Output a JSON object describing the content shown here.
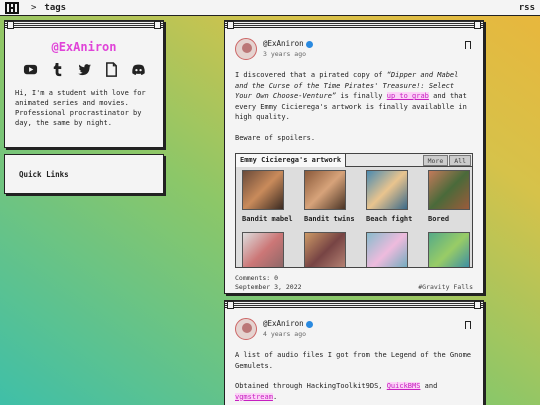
{
  "topbar": {
    "separator": ">",
    "breadcrumb": "tags",
    "rss": "rss"
  },
  "profile": {
    "handle": "@ExAniron",
    "socials": [
      "youtube-icon",
      "tumblr-icon",
      "twitter-icon",
      "document-icon",
      "discord-icon"
    ],
    "bio": "Hi, I'm a student with love for animated series and movies. Professional procrastinator by day, the same by night."
  },
  "quick_links": {
    "title": "Quick Links"
  },
  "posts": [
    {
      "author": "@ExAniron",
      "time": "3 years ago",
      "body": {
        "t1": "I discovered that a pirated copy of ",
        "title": "“Dipper and Mabel and the Curse of the Time Pirates' Treasure!: Select Your Own Choose-Venture”",
        "t2": " is finally ",
        "link": "up to grab",
        "t3": " and that every Emmy Cicierega's artwork is finally availablle in high quality.",
        "p2": "Beware of spoilers."
      },
      "gallery": {
        "title": "Emmy Cicierega's artwork",
        "buttons": [
          "More",
          "All"
        ],
        "items": [
          "Bandit mabel",
          "Bandit twins",
          "Beach fight",
          "Bored",
          "",
          "",
          "",
          ""
        ]
      },
      "comments": "Comments: 0",
      "date": "September 3, 2022",
      "tag": "#Gravity Falls"
    },
    {
      "author": "@ExAniron",
      "time": "4 years ago",
      "body": {
        "p1": "A list of audio files I got from the Legend of the Gnome Gemulets.",
        "t1": "Obtained through HackingToolkit9DS, ",
        "link1": "QuickBMS",
        "t2": " and ",
        "link2": "vgmstream",
        "t3": "."
      }
    }
  ],
  "colors": {
    "accent": "#e044d8",
    "link_bg": "#fcd2f7",
    "verified": "#2a8ae0"
  }
}
